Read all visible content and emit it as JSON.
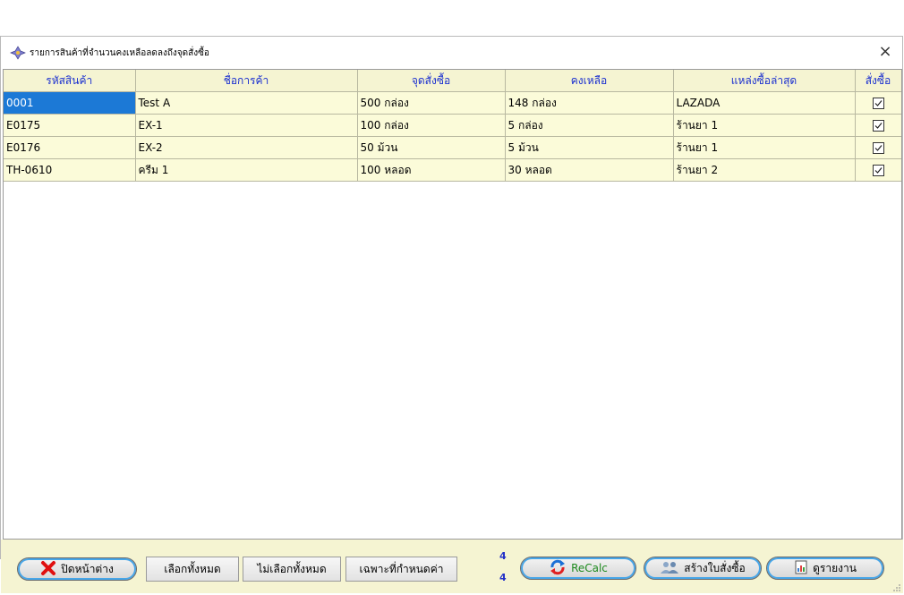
{
  "window": {
    "title": "รายการสินค้าที่จำนวนคงเหลือลดลงถึงจุดสั่งซื้อ",
    "close_label": "×"
  },
  "table": {
    "columns": [
      "รหัสสินค้า",
      "ชื่อการค้า",
      "จุดสั่งซื้อ",
      "คงเหลือ",
      "แหล่งซื้อล่าสุด",
      "สั่งซื้อ"
    ],
    "rows": [
      {
        "code": "0001",
        "name": "Test A",
        "reorder": "500 กล่อง",
        "remaining": "148 กล่อง",
        "source": "LAZADA",
        "order": true
      },
      {
        "code": "E0175",
        "name": "EX-1",
        "reorder": "100 กล่อง",
        "remaining": "5 กล่อง",
        "source": "ร้านยา 1",
        "order": true
      },
      {
        "code": "E0176",
        "name": "EX-2",
        "reorder": "50 ม้วน",
        "remaining": "5 ม้วน",
        "source": "ร้านยา 1",
        "order": true
      },
      {
        "code": "TH-0610",
        "name": "ครีม 1",
        "reorder": "100 หลอด",
        "remaining": "30 หลอด",
        "source": "ร้านยา 2",
        "order": true
      }
    ]
  },
  "footer": {
    "close_window_label": "ปิดหน้าต่าง",
    "select_all_label": "เลือกทั้งหมด",
    "deselect_all_label": "ไม่เลือกทั้งหมด",
    "specific_only_label": "เฉพาะที่กำหนดค่า",
    "count_top": "4",
    "count_bottom": "4",
    "recalc_label": "ReCalc",
    "create_po_label": "สร้างใบสั่งซื้อ",
    "view_report_label": "ดูรายงาน"
  },
  "colors": {
    "header_text": "#1a2fd0",
    "row_bg": "#fbfbd9",
    "selected_bg": "#1c79d6",
    "pill_border_accent": "#47a6e8",
    "recalc_text": "#1f8a1f"
  }
}
